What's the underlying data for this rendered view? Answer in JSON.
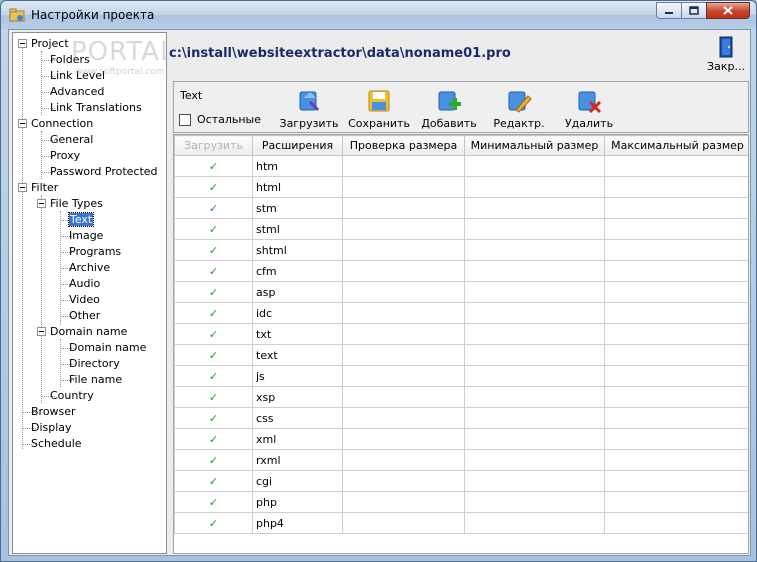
{
  "window": {
    "title": "Настройки проекта",
    "watermark": "PORTAL",
    "watermark_sub": "www.softportal.com"
  },
  "tree": {
    "project": "Project",
    "folders": "Folders",
    "link_level": "Link Level",
    "advanced": "Advanced",
    "link_translations": "Link Translations",
    "connection": "Connection",
    "general": "General",
    "proxy": "Proxy",
    "password_protected": "Password Protected",
    "filter": "Filter",
    "file_types": "File Types",
    "text": "Text",
    "image": "Image",
    "programs": "Programs",
    "archive": "Archive",
    "audio": "Audio",
    "video": "Video",
    "other": "Other",
    "domain_name_group": "Domain name",
    "domain_name": "Domain name",
    "directory": "Directory",
    "file_name": "File name",
    "country": "Country",
    "browser": "Browser",
    "display": "Display",
    "schedule": "Schedule"
  },
  "header": {
    "path": "c:\\install\\websiteextractor\\data\\noname01.pro",
    "close_label": "Закр..."
  },
  "toolbar": {
    "title": "Text",
    "checkbox_label": "Остальные",
    "load": "Загрузить",
    "save": "Сохранить",
    "add": "Добавить",
    "edit": "Редактр.",
    "delete": "Удалить"
  },
  "grid": {
    "columns": [
      "Загрузить",
      "Расширения",
      "Проверка размера",
      "Минимальный размер",
      "Максимальный размер"
    ],
    "check_mark": "✓",
    "rows": [
      {
        "ext": "htm"
      },
      {
        "ext": "html"
      },
      {
        "ext": "stm"
      },
      {
        "ext": "stml"
      },
      {
        "ext": "shtml"
      },
      {
        "ext": "cfm"
      },
      {
        "ext": "asp"
      },
      {
        "ext": "idc"
      },
      {
        "ext": "txt"
      },
      {
        "ext": "text"
      },
      {
        "ext": "js"
      },
      {
        "ext": "xsp"
      },
      {
        "ext": "css"
      },
      {
        "ext": "xml"
      },
      {
        "ext": "rxml"
      },
      {
        "ext": "cgi"
      },
      {
        "ext": "php"
      },
      {
        "ext": "php4"
      }
    ]
  },
  "colors": {
    "accent": "#3875d7",
    "path_text": "#1a2a6c",
    "check_green": "#1f9a1f",
    "close_red": "#c8452a"
  }
}
